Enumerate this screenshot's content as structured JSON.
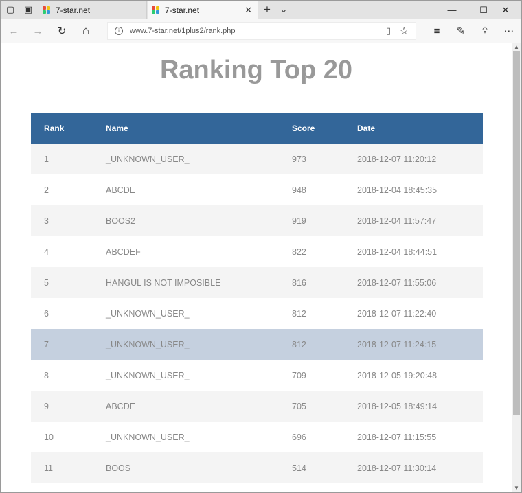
{
  "browser": {
    "tabs": [
      {
        "title": "7-star.net",
        "active": false
      },
      {
        "title": "7-star.net",
        "active": true
      }
    ],
    "url": "www.7-star.net/1plus2/rank.php",
    "icons": {
      "back": "←",
      "forward": "→",
      "refresh": "↻",
      "home": "⌂",
      "new_tab": "+",
      "tab_list": "⌄",
      "minimize": "—",
      "maximize": "☐",
      "close": "✕",
      "favorites": "☆",
      "reading_list": "≡",
      "notes": "✎",
      "share": "⇪",
      "more": "⋯",
      "reader": "▯",
      "info": "i",
      "tab_close": "✕",
      "set_aside": "▣",
      "tabs_aside": "▢"
    }
  },
  "page": {
    "title": "Ranking Top 20",
    "columns": [
      "Rank",
      "Name",
      "Score",
      "Date"
    ],
    "rows": [
      {
        "rank": "1",
        "name": "_UNKNOWN_USER_",
        "score": "973",
        "date": "2018-12-07 11:20:12"
      },
      {
        "rank": "2",
        "name": "ABCDE",
        "score": "948",
        "date": "2018-12-04 18:45:35"
      },
      {
        "rank": "3",
        "name": "BOOS2",
        "score": "919",
        "date": "2018-12-04 11:57:47"
      },
      {
        "rank": "4",
        "name": "ABCDEF",
        "score": "822",
        "date": "2018-12-04 18:44:51"
      },
      {
        "rank": "5",
        "name": "HANGUL IS NOT IMPOSIBLE",
        "score": "816",
        "date": "2018-12-07 11:55:06"
      },
      {
        "rank": "6",
        "name": "_UNKNOWN_USER_",
        "score": "812",
        "date": "2018-12-07 11:22:40"
      },
      {
        "rank": "7",
        "name": "_UNKNOWN_USER_",
        "score": "812",
        "date": "2018-12-07 11:24:15"
      },
      {
        "rank": "8",
        "name": "_UNKNOWN_USER_",
        "score": "709",
        "date": "2018-12-05 19:20:48"
      },
      {
        "rank": "9",
        "name": "ABCDE",
        "score": "705",
        "date": "2018-12-05 18:49:14"
      },
      {
        "rank": "10",
        "name": "_UNKNOWN_USER_",
        "score": "696",
        "date": "2018-12-07 11:15:55"
      },
      {
        "rank": "11",
        "name": "BOOS",
        "score": "514",
        "date": "2018-12-07 11:30:14"
      }
    ],
    "colors": {
      "header_bg": "#336699",
      "highlight_row": "#c5d0df",
      "title": "#999999"
    }
  }
}
